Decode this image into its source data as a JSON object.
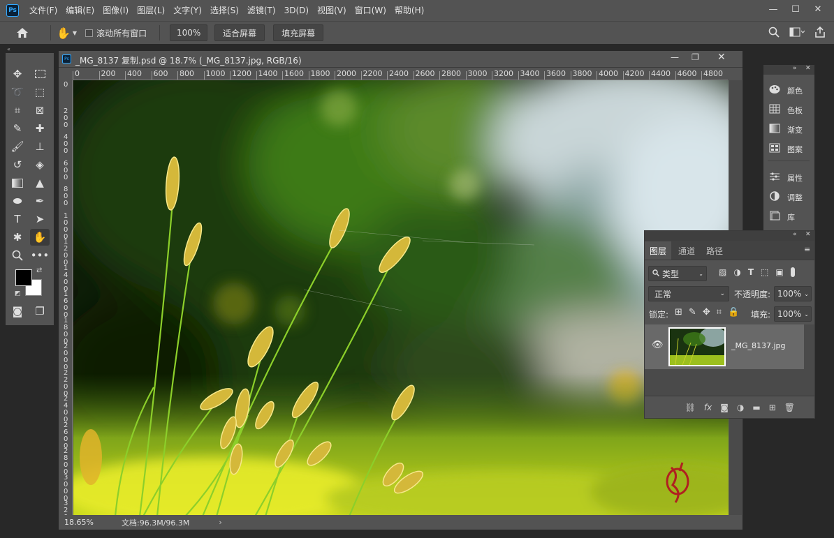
{
  "app": {
    "logo": "Ps"
  },
  "menu": [
    "文件(F)",
    "编辑(E)",
    "图像(I)",
    "图层(L)",
    "文字(Y)",
    "选择(S)",
    "滤镜(T)",
    "3D(D)",
    "视图(V)",
    "窗口(W)",
    "帮助(H)"
  ],
  "options": {
    "scroll_all_label": "滚动所有窗口",
    "zoom_value": "100%",
    "fit_screen": "适合屏幕",
    "fill_screen": "填充屏幕"
  },
  "document": {
    "tab_title": "_MG_8137 复制.psd @ 18.7% (_MG_8137.jpg, RGB/16)",
    "ruler_top": [
      "0",
      "200",
      "400",
      "600",
      "800",
      "1000",
      "1200",
      "1400",
      "1600",
      "1800",
      "2000",
      "2200",
      "2400",
      "2600",
      "2800",
      "3000",
      "3200",
      "3400",
      "3600",
      "3800",
      "4000",
      "4200",
      "4400",
      "4600",
      "4800"
    ],
    "ruler_left": [
      "0",
      "200",
      "400",
      "600",
      "800",
      "1000",
      "1200",
      "1400",
      "1600",
      "1800",
      "2000",
      "2200",
      "2400",
      "2600",
      "2800",
      "3000",
      "3200"
    ],
    "zoom_status": "18.65%",
    "doc_size": "文档:96.3M/96.3M"
  },
  "right_panel": {
    "items": [
      {
        "label": "颜色",
        "icon": "palette-icon"
      },
      {
        "label": "色板",
        "icon": "swatches-icon"
      },
      {
        "label": "渐变",
        "icon": "gradient-icon"
      },
      {
        "label": "图案",
        "icon": "pattern-icon"
      },
      {
        "label": "属性",
        "icon": "properties-icon"
      },
      {
        "label": "调整",
        "icon": "adjustments-icon"
      },
      {
        "label": "库",
        "icon": "libraries-icon"
      }
    ]
  },
  "layers_panel": {
    "tabs": [
      "图层",
      "通道",
      "路径"
    ],
    "filter_kind": "类型",
    "blend_mode": "正常",
    "opacity_label": "不透明度:",
    "opacity_value": "100%",
    "lock_label": "锁定:",
    "fill_label": "填充:",
    "fill_value": "100%",
    "layers": [
      {
        "name": "_MG_8137.jpg",
        "visible": true
      }
    ]
  },
  "colors": {
    "accent": "#31a8ff",
    "panel": "#535353",
    "dark": "#282828"
  }
}
